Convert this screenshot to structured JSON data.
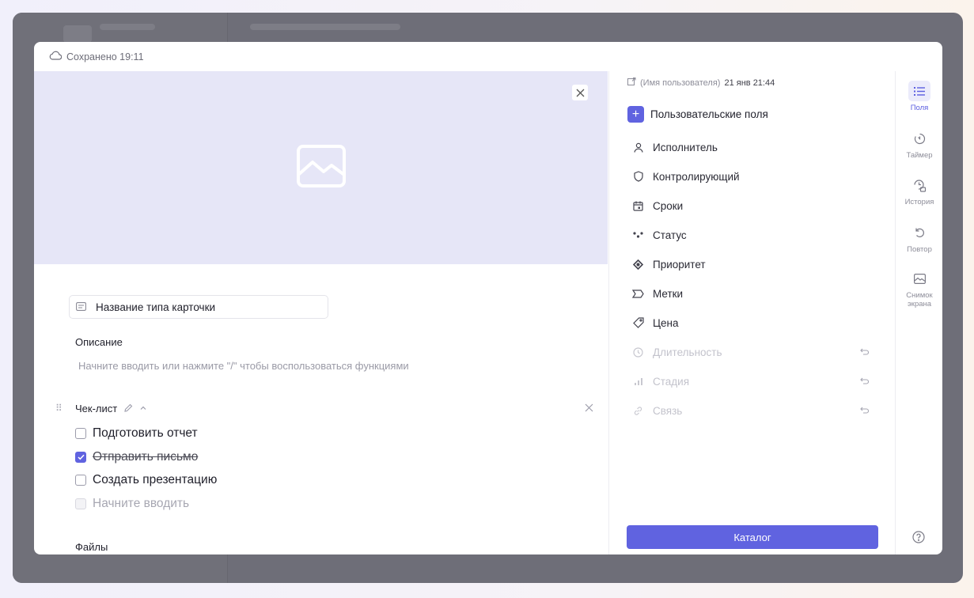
{
  "header": {
    "save_status": "Сохранено 19:11"
  },
  "checklist": {
    "title": "Чек-лист",
    "items": [
      {
        "label": "Подготовить отчет",
        "checked": false
      },
      {
        "label": "Отправить письмо",
        "checked": true
      },
      {
        "label": "Создать презентацию",
        "checked": false
      }
    ],
    "new_item_placeholder": "Начните вводить"
  },
  "card": {
    "title_value": "Название типа карточки",
    "description_label": "Описание",
    "description_placeholder": "Начните вводить или нажмите \"/\" чтобы воспользоваться функциями",
    "files_label": "Файлы"
  },
  "sidepanel": {
    "meta_user": "(Имя пользователя)",
    "meta_time": "21 янв 21:44",
    "custom_fields_label": "Пользовательские поля",
    "properties": [
      {
        "label": "Исполнитель",
        "icon": "user-icon",
        "enabled": true
      },
      {
        "label": "Контролирующий",
        "icon": "shield-icon",
        "enabled": true
      },
      {
        "label": "Сроки",
        "icon": "calendar-icon",
        "enabled": true
      },
      {
        "label": "Статус",
        "icon": "status-dots-icon",
        "enabled": true
      },
      {
        "label": "Приоритет",
        "icon": "priority-icon",
        "enabled": true
      },
      {
        "label": "Метки",
        "icon": "label-icon",
        "enabled": true
      },
      {
        "label": "Цена",
        "icon": "price-tag-icon",
        "enabled": true
      },
      {
        "label": "Длительность",
        "icon": "clock-icon",
        "enabled": false
      },
      {
        "label": "Стадия",
        "icon": "stage-bars-icon",
        "enabled": false
      },
      {
        "label": "Связь",
        "icon": "link-icon",
        "enabled": false
      }
    ],
    "catalog_button": "Каталог"
  },
  "rail": {
    "tabs": [
      {
        "label": "Поля",
        "active": true
      },
      {
        "label": "Таймер",
        "active": false
      },
      {
        "label": "История",
        "active": false
      },
      {
        "label": "Повтор",
        "active": false
      },
      {
        "label": "Снимок экрана",
        "active": false
      }
    ]
  },
  "colors": {
    "accent": "#6063e0",
    "cover": "#e6e6f7"
  }
}
